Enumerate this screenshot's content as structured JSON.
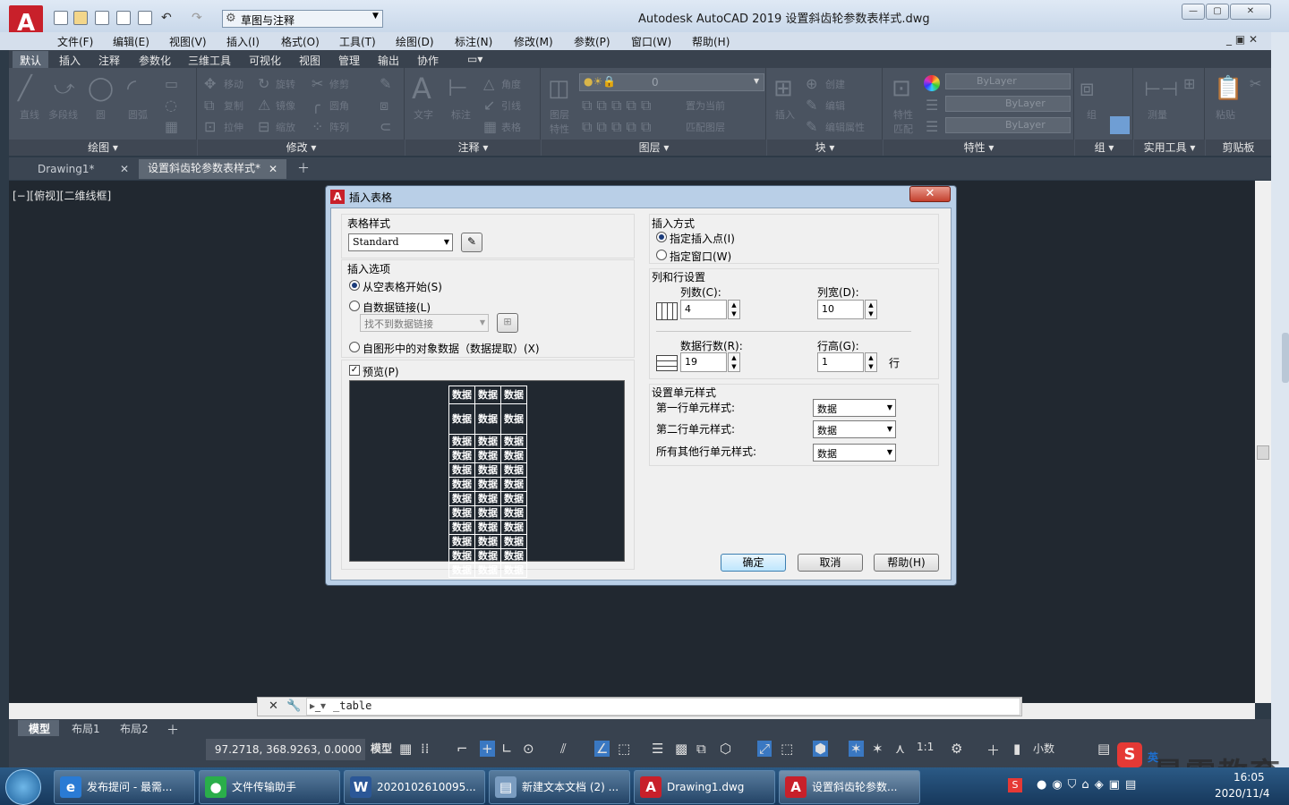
{
  "app": {
    "window_title": "Autodesk AutoCAD 2019    设置斜齿轮参数表样式.dwg",
    "workspace": "草图与注释",
    "logo_letter": "A"
  },
  "menu": [
    "文件(F)",
    "编辑(E)",
    "视图(V)",
    "插入(I)",
    "格式(O)",
    "工具(T)",
    "绘图(D)",
    "标注(N)",
    "修改(M)",
    "参数(P)",
    "窗口(W)",
    "帮助(H)"
  ],
  "ribbon_tabs": [
    "默认",
    "插入",
    "注释",
    "参数化",
    "三维工具",
    "可视化",
    "视图",
    "管理",
    "输出",
    "协作"
  ],
  "ribbon": {
    "draw_tools": [
      "直线",
      "多段线",
      "圆",
      "圆弧"
    ],
    "modify_tools": [
      "移动",
      "旋转",
      "修剪",
      "复制",
      "镜像",
      "圆角",
      "拉伸",
      "缩放",
      "阵列"
    ],
    "annotation_tools": [
      "文字",
      "标注",
      "线性",
      "引线",
      "表格"
    ],
    "layer_tools": [
      "图层特性",
      "置为当前",
      "匹配图层"
    ],
    "layer_value": "0",
    "block_tools": [
      "插入",
      "创建",
      "编辑",
      "编辑属性"
    ],
    "property_tools": [
      "特性匹配"
    ],
    "bylayer": [
      "ByLayer",
      "ByLayer",
      "ByLayer"
    ],
    "group_tool": "组",
    "utility_tool": "测量",
    "clipboard_tool": "粘贴",
    "panels": [
      "绘图 ▾",
      "修改 ▾",
      "注释 ▾",
      "图层 ▾",
      "块 ▾",
      "特性 ▾",
      "组 ▾",
      "实用工具 ▾",
      "剪贴板"
    ]
  },
  "doc_tabs": [
    "Drawing1*",
    "设置斜齿轮参数表样式*"
  ],
  "viewport_label": "[−][俯视][二维线框]",
  "command_line": "_table",
  "layout_tabs": [
    "模型",
    "布局1",
    "布局2"
  ],
  "status": {
    "coords": "97.2718, 368.9263, 0.0000",
    "model": "模型",
    "scale": "1:1",
    "units": "小数"
  },
  "dialog": {
    "title": "插入表格",
    "table_style_label": "表格样式",
    "table_style_value": "Standard",
    "insert_options_label": "插入选项",
    "opt_empty": "从空表格开始(S)",
    "opt_datalink": "自数据链接(L)",
    "datalink_value": "找不到数据链接",
    "opt_extract": "自图形中的对象数据（数据提取）(X)",
    "preview_label": "预览(P)",
    "insert_method_label": "插入方式",
    "method_point": "指定插入点(I)",
    "method_window": "指定窗口(W)",
    "col_row_label": "列和行设置",
    "columns_label": "列数(C):",
    "columns_value": "4",
    "col_width_label": "列宽(D):",
    "col_width_value": "10",
    "data_rows_label": "数据行数(R):",
    "data_rows_value": "19",
    "row_height_label": "行高(G):",
    "row_height_value": "1",
    "row_unit": "行",
    "cell_style_label": "设置单元样式",
    "first_row_label": "第一行单元样式:",
    "first_row_value": "数据",
    "second_row_label": "第二行单元样式:",
    "second_row_value": "数据",
    "other_rows_label": "所有其他行单元样式:",
    "other_rows_value": "数据",
    "ok": "确定",
    "cancel": "取消",
    "help": "帮助(H)",
    "preview_cell": "数据"
  },
  "taskbar": [
    {
      "label": "发布提问 - 最需...",
      "icon": "e",
      "color": "#2a7bd4"
    },
    {
      "label": "文件传输助手",
      "icon": "●",
      "color": "#2aae4a"
    },
    {
      "label": "2020102610095...",
      "icon": "W",
      "color": "#2b5797"
    },
    {
      "label": "新建文本文档 (2) ...",
      "icon": "▤",
      "color": "#7a9cc0"
    },
    {
      "label": "Drawing1.dwg",
      "icon": "A",
      "color": "#c8202a"
    },
    {
      "label": "设置斜齿轮参数...",
      "icon": "A",
      "color": "#c8202a"
    }
  ],
  "tray": {
    "ime": "英",
    "date": "2020/11/4",
    "time": "16:05"
  },
  "watermark": "最需教育"
}
